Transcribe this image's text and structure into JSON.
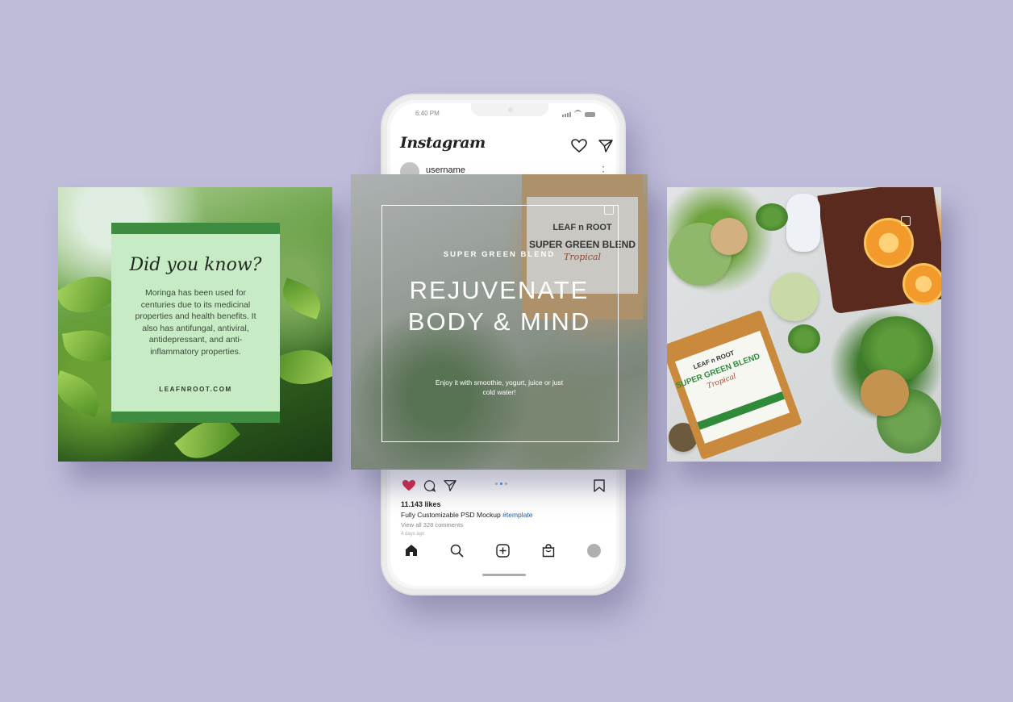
{
  "phone": {
    "status_time": "6:40 PM",
    "app_name": "Instagram",
    "username": "username",
    "likes": "11.143 likes",
    "caption_text": "Fully Customizable PSD Mockup ",
    "caption_tag": "#template",
    "comments": "View all 328 comments",
    "time_ago": "4 days ago"
  },
  "left_card": {
    "title": "Did you know?",
    "body": "Moringa has been used for centuries due to its medicinal properties and health benefits. It also has antifungal, antiviral, antidepressant, and anti-inflammatory properties.",
    "url": "LEAFNROOT.COM"
  },
  "center_card": {
    "kicker": "SUPER GREEN BLEND",
    "headline": "REJUVENATE BODY & MIND",
    "subtext": "Enjoy it with smoothie, yogurt, juice or just cold water!",
    "product_brand": "LEAF n ROOT",
    "product_name": "SUPER GREEN BLEND",
    "product_variant": "Tropical"
  },
  "right_card": {
    "product_brand": "LEAF n ROOT",
    "product_name": "SUPER GREEN BLEND",
    "product_variant": "Tropical"
  },
  "colors": {
    "background": "#bfbcda",
    "info_box": "#c7ebc4",
    "info_band": "#3e8c3f",
    "like_active": "#e0284a",
    "hashtag": "#2a5c9a"
  },
  "icons": [
    "instagram-wordmark",
    "chevron-down-icon",
    "heart-icon",
    "send-icon",
    "more-icon",
    "comment-icon",
    "bookmark-icon",
    "home-icon",
    "search-icon",
    "add-post-icon",
    "shop-icon",
    "profile-avatar"
  ]
}
